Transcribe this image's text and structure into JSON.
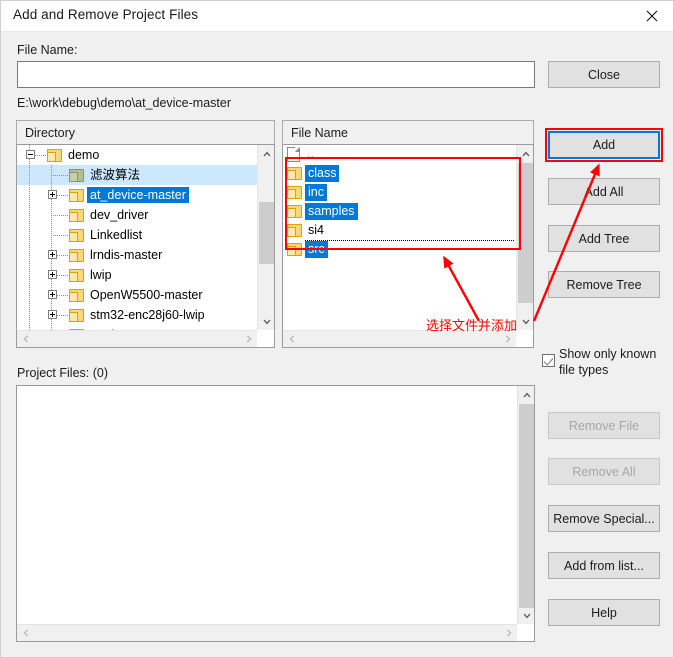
{
  "window": {
    "title": "Add and Remove Project Files",
    "close_icon": "close-icon"
  },
  "form": {
    "file_name_label": "File Name:",
    "file_name_value": "",
    "current_path": "E:\\work\\debug\\demo\\at_device-master",
    "project_files_label": "Project Files: (0)"
  },
  "directory_panel": {
    "header": "Directory",
    "items": [
      {
        "label": "demo",
        "depth": 2,
        "expander": "minus",
        "icon": "folder-icon",
        "state": "normal"
      },
      {
        "label": "滤波算法",
        "depth": 3,
        "expander": "none",
        "icon": "folder-icon-green",
        "state": "hover"
      },
      {
        "label": "at_device-master",
        "depth": 3,
        "expander": "plus",
        "icon": "folder-icon",
        "state": "selected"
      },
      {
        "label": "dev_driver",
        "depth": 3,
        "expander": "none",
        "icon": "folder-icon",
        "state": "normal"
      },
      {
        "label": "Linkedlist",
        "depth": 3,
        "expander": "none",
        "icon": "folder-icon",
        "state": "normal"
      },
      {
        "label": "lrndis-master",
        "depth": 3,
        "expander": "plus",
        "icon": "folder-icon",
        "state": "normal"
      },
      {
        "label": "lwip",
        "depth": 3,
        "expander": "plus",
        "icon": "folder-icon",
        "state": "normal"
      },
      {
        "label": "OpenW5500-master",
        "depth": 3,
        "expander": "plus",
        "icon": "folder-icon",
        "state": "normal"
      },
      {
        "label": "stm32-enc28j60-lwip",
        "depth": 3,
        "expander": "plus",
        "icon": "folder-icon",
        "state": "normal"
      },
      {
        "label": "trunk",
        "depth": 3,
        "expander": "plus",
        "icon": "folder-icon",
        "state": "normal"
      },
      {
        "label": "",
        "depth": 3,
        "expander": "none",
        "icon": "folder-icon",
        "state": "normal"
      }
    ]
  },
  "file_panel": {
    "header": "File Name",
    "items": [
      {
        "label": "..",
        "icon": "page-icon",
        "selected": false,
        "focused": false
      },
      {
        "label": "class",
        "icon": "folder-icon",
        "selected": true,
        "focused": false
      },
      {
        "label": "inc",
        "icon": "folder-icon",
        "selected": true,
        "focused": false
      },
      {
        "label": "samples",
        "icon": "folder-icon",
        "selected": true,
        "focused": false
      },
      {
        "label": "si4",
        "icon": "folder-icon",
        "selected": false,
        "focused": false
      },
      {
        "label": "src",
        "icon": "folder-icon",
        "selected": true,
        "focused": true
      }
    ]
  },
  "buttons": {
    "close": "Close",
    "add": "Add",
    "add_all": "Add All",
    "add_tree": "Add Tree",
    "remove_tree": "Remove Tree",
    "remove_file": "Remove File",
    "remove_all": "Remove All",
    "remove_special": "Remove Special...",
    "add_from_list": "Add from list...",
    "help": "Help"
  },
  "checkbox": {
    "label_line1": "Show only known",
    "label_line2": "file types",
    "checked": true
  },
  "annotation": {
    "text": "选择文件并添加",
    "color": "#ff0000"
  },
  "scrollbars": {
    "up_arrow": "chevron-up-icon",
    "down_arrow": "chevron-down-icon",
    "left_arrow": "chevron-left-icon",
    "right_arrow": "chevron-right-icon"
  },
  "colors": {
    "accent": "#0078d7",
    "annotation": "#ff0000",
    "dialog_bg": "#f0f0f0",
    "folder": "#fbd77a"
  }
}
